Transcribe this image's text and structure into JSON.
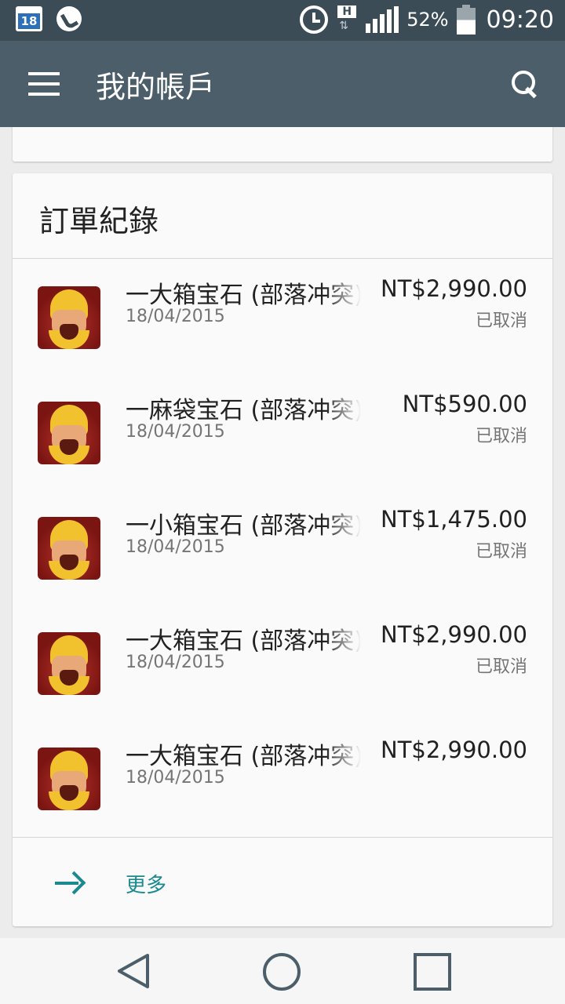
{
  "status_bar": {
    "calendar_day": "18",
    "battery_percent": "52%",
    "time": "09:20",
    "network_type": "H",
    "icons": [
      "calendar-icon",
      "phone-icon",
      "alarm-icon",
      "network-icon",
      "signal-icon",
      "battery-icon"
    ]
  },
  "toolbar": {
    "title": "我的帳戶",
    "menu_icon": "menu-icon",
    "search_icon": "search-icon"
  },
  "orders": {
    "header": "訂單紀錄",
    "items": [
      {
        "title": "一大箱宝石 (部落冲突)",
        "date": "18/04/2015",
        "price": "NT$2,990.00",
        "status": "已取消"
      },
      {
        "title": "一麻袋宝石 (部落冲突)",
        "date": "18/04/2015",
        "price": "NT$590.00",
        "status": "已取消"
      },
      {
        "title": "一小箱宝石 (部落冲突)",
        "date": "18/04/2015",
        "price": "NT$1,475.00",
        "status": "已取消"
      },
      {
        "title": "一大箱宝石 (部落冲突)",
        "date": "18/04/2015",
        "price": "NT$2,990.00",
        "status": "已取消"
      },
      {
        "title": "一大箱宝石 (部落冲突)",
        "date": "18/04/2015",
        "price": "NT$2,990.00",
        "status": ""
      }
    ],
    "more_label": "更多"
  },
  "colors": {
    "status_bar": "#3b4c57",
    "toolbar": "#4c5e69",
    "accent": "#1a8a8f",
    "card": "#fafafa",
    "background": "#ececec"
  }
}
